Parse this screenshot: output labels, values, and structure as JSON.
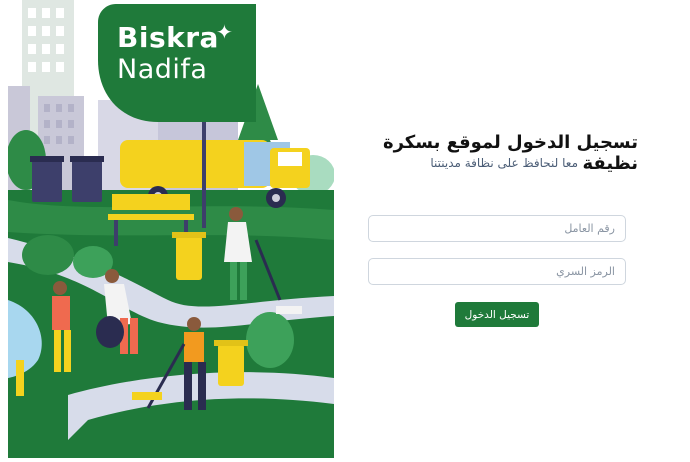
{
  "brand": {
    "line1": "Biskra",
    "line2": "Nadifa",
    "color": "#1f7a3a"
  },
  "login": {
    "title": "تسجيل الدخول لموقع بسكرة نظيفة",
    "subtitle": "معا لنحافظ على نظافة مدينتنا",
    "worker_id_placeholder": "رقم العامل",
    "password_placeholder": "الرمز السري",
    "submit_label": "تسجيل الدخول",
    "button_color": "#1f7a3a"
  }
}
